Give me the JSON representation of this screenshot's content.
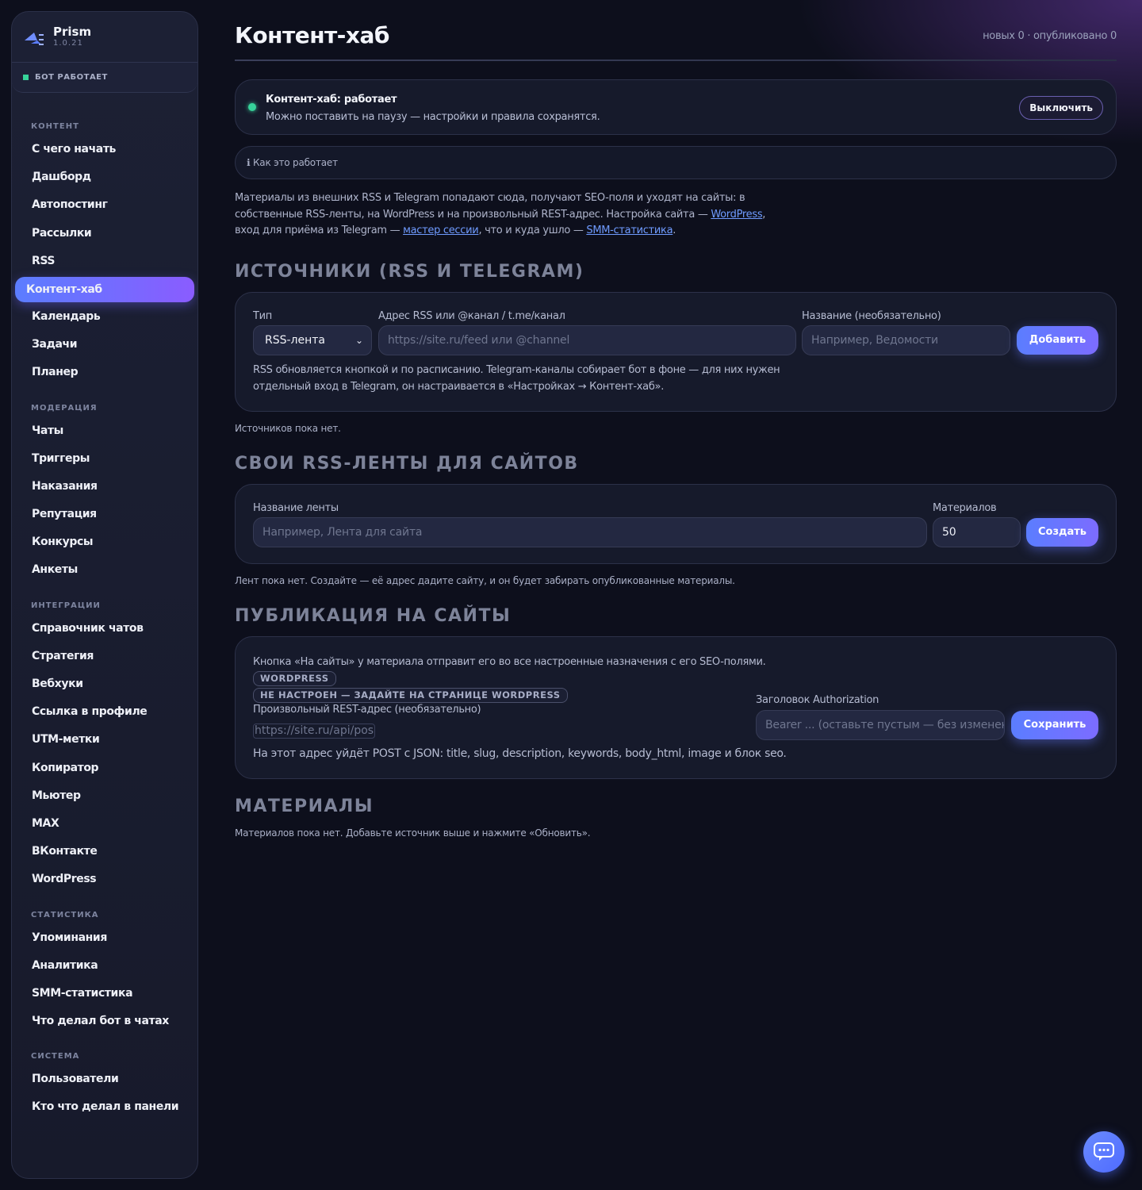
{
  "app": {
    "name": "Prism",
    "version": "1.0.21",
    "status": "БОТ РАБОТАЕТ"
  },
  "sidebar": {
    "sections": [
      {
        "title": "КОНТЕНТ",
        "items": [
          "С чего начать",
          "Дашборд",
          "Автопостинг",
          "Рассылки",
          "RSS",
          "Контент-хаб",
          "Календарь",
          "Задачи",
          "Планер"
        ]
      },
      {
        "title": "МОДЕРАЦИЯ",
        "items": [
          "Чаты",
          "Триггеры",
          "Наказания",
          "Репутация",
          "Конкурсы",
          "Анкеты"
        ]
      },
      {
        "title": "ИНТЕГРАЦИИ",
        "items": [
          "Справочник чатов",
          "Стратегия",
          "Вебхуки",
          "Ссылка в профиле",
          "UTM-метки",
          "Копиратор",
          "Мьютер",
          "MAX",
          "ВКонтакте",
          "WordPress"
        ]
      },
      {
        "title": "СТАТИСТИКА",
        "items": [
          "Упоминания",
          "Аналитика",
          "SMM-статистика",
          "Что делал бот в чатах"
        ]
      },
      {
        "title": "СИСТЕМА",
        "items": [
          "Пользователи",
          "Кто что делал в панели"
        ]
      }
    ],
    "active": "Контент-хаб"
  },
  "header": {
    "title": "Контент-хаб",
    "counts": "новых 0 · опубликовано 0"
  },
  "hub": {
    "title": "Контент-хаб: работает",
    "subtitle": "Можно поставить на паузу — настройки и правила сохранятся.",
    "toggle_label": "Выключить"
  },
  "how": {
    "label": "ℹ Как это работает"
  },
  "intro": {
    "part1": "Материалы из внешних RSS и Telegram попадают сюда, получают SEO-поля и уходят на сайты: в собственные RSS-ленты, на WordPress и на произвольный REST-адрес. Настройка сайта — ",
    "link1": "WordPress",
    "part2": ", вход для приёма из Telegram — ",
    "link2": "мастер сессии",
    "part3": ", что и куда ушло — ",
    "link3": "SMM-статистика",
    "part4": "."
  },
  "sources": {
    "heading": "Источники (RSS и Telegram)",
    "type_label": "Тип",
    "type_value": "RSS-лента",
    "address_label": "Адрес RSS или @канал / t.me/канал",
    "address_placeholder": "https://site.ru/feed или @channel",
    "name_label": "Название (необязательно)",
    "name_placeholder": "Например, Ведомости",
    "add_label": "Добавить",
    "hint": "RSS обновляется кнопкой и по расписанию. Telegram-каналы собирает бот в фоне — для них нужен отдельный вход в Telegram, он настраивается в «Настройках → Контент-хаб».",
    "empty": "Источников пока нет."
  },
  "feeds": {
    "heading": "Свои RSS-ленты для сайтов",
    "name_label": "Название ленты",
    "name_placeholder": "Например, Лента для сайта",
    "count_label": "Материалов",
    "count_value": "50",
    "create_label": "Создать",
    "empty": "Лент пока нет. Создайте — её адрес дадите сайту, и он будет забирать опубликованные материалы."
  },
  "publish": {
    "heading": "Публикация на сайты",
    "text": "Кнопка «На сайты» у материала отправит его во все настроенные назначения с его SEO-полями.",
    "badge_line1": "WORDPRESS",
    "badge_line2": "НЕ НАСТРОЕН — ЗАДАЙТЕ НА СТРАНИЦЕ WORDPRESS",
    "rest_label": "Произвольный REST-адрес (необязательно)",
    "rest_placeholder": "https://site.ru/api/pos",
    "auth_label": "Заголовок Authorization",
    "auth_placeholder": "Bearer ... (оставьте пустым — без изменений)",
    "save_label": "Сохранить",
    "hint": "На этот адрес уйдёт POST с JSON: title, slug, description, keywords, body_html, image и блок seo."
  },
  "materials": {
    "heading": "Материалы",
    "empty": "Материалов пока нет. Добавьте источник выше и нажмите «Обновить»."
  },
  "icons": {
    "logo": "prism-logo-icon",
    "chat": "chat-bubble-icon",
    "select": "chevron-down-icon"
  },
  "colors": {
    "accent": "#5b7dff",
    "accent2": "#8a5cff",
    "ok": "#37d39a",
    "bg": "#0d0f1c"
  }
}
